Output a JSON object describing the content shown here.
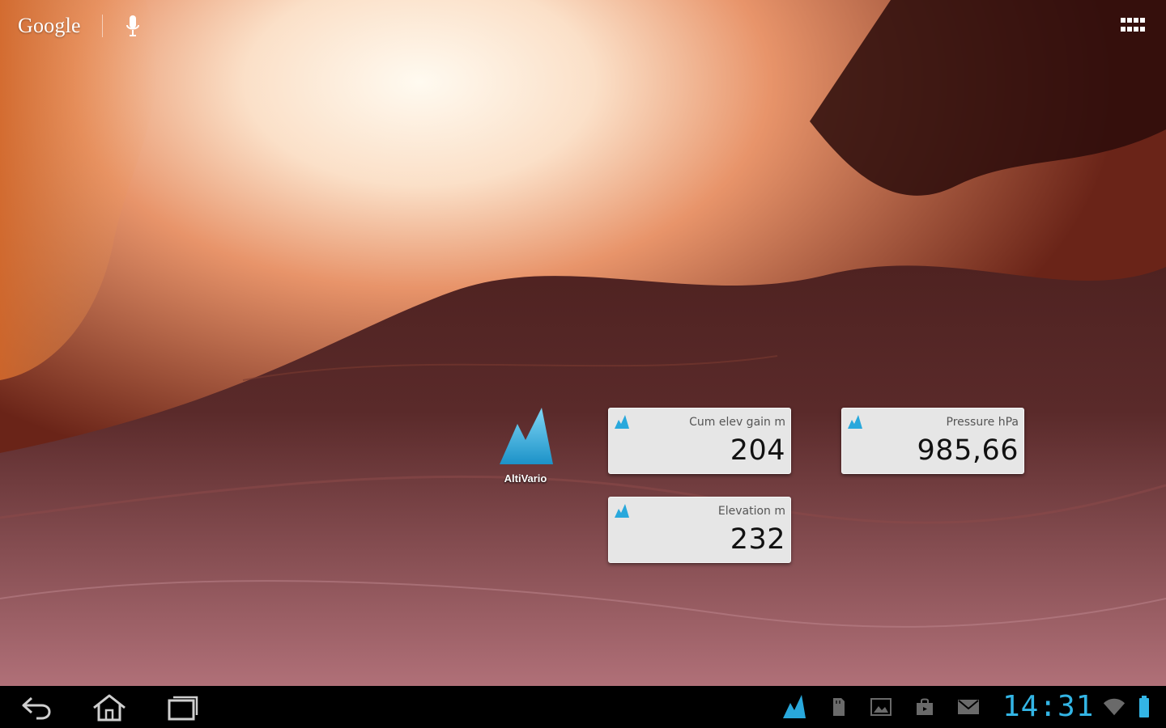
{
  "top_bar": {
    "search_logo": "Google",
    "mic_icon": "mic-icon",
    "apps_icon": "apps-grid-icon"
  },
  "shortcut": {
    "label": "AltiVario",
    "icon": "altivario-mountain-icon",
    "accent": "#29a8dc"
  },
  "widgets": [
    {
      "label": "Cum elev gain m",
      "value": "204"
    },
    {
      "label": "Pressure hPa",
      "value": "985,66"
    },
    {
      "label": "Elevation m",
      "value": "232"
    }
  ],
  "nav_bar": {
    "back_icon": "back-icon",
    "home_icon": "home-icon",
    "recents_icon": "recent-apps-icon"
  },
  "status_tray": {
    "icons": [
      "altivario-notification-icon",
      "sd-card-icon",
      "picture-icon",
      "shopping-bag-icon",
      "gmail-icon"
    ],
    "clock": "14:31",
    "clock_color": "#33b5e5",
    "wifi_icon": "wifi-icon",
    "battery_icon": "battery-icon"
  }
}
